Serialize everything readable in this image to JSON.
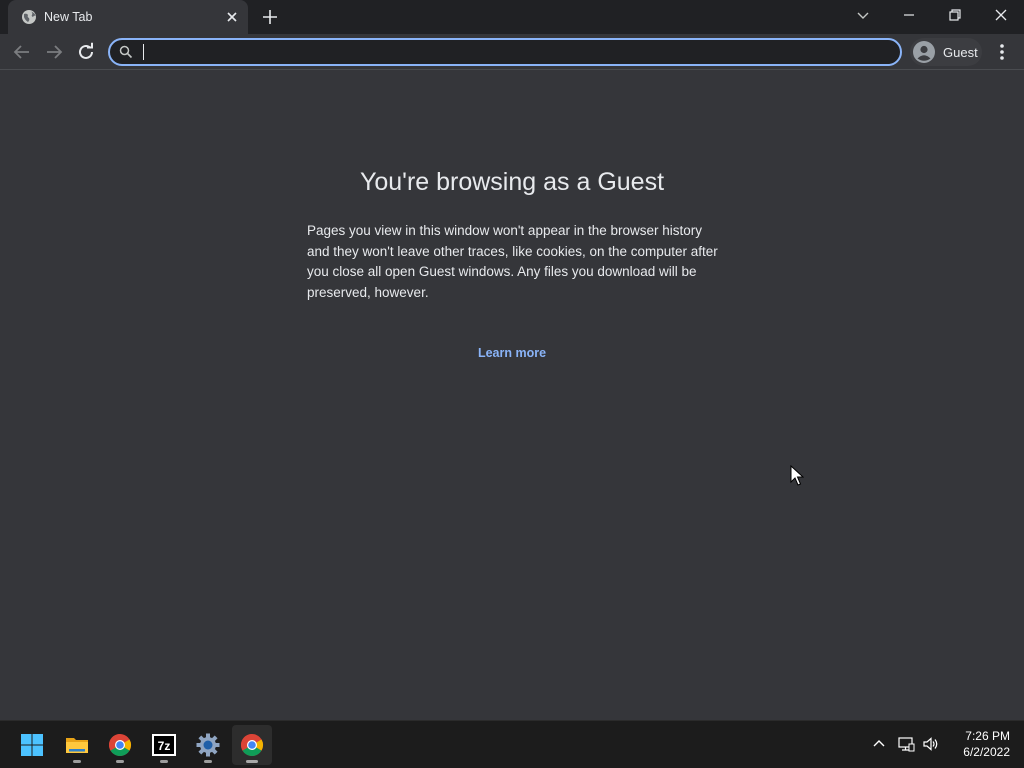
{
  "browser": {
    "tab": {
      "title": "New Tab",
      "favicon": "globe-icon"
    },
    "omnibox": {
      "value": "",
      "placeholder": ""
    },
    "profile": {
      "label": "Guest",
      "icon": "avatar-icon"
    }
  },
  "content": {
    "heading": "You're browsing as a Guest",
    "description": "Pages you view in this window won't appear in the browser history and they won't leave other traces, like cookies, on the computer after you close all open Guest windows. Any files you download will be preserved, however.",
    "learn_more": "Learn more"
  },
  "taskbar": {
    "apps": [
      {
        "name": "start",
        "icon": "windows-logo-icon"
      },
      {
        "name": "file-explorer",
        "icon": "folder-icon"
      },
      {
        "name": "chrome",
        "icon": "chrome-icon"
      },
      {
        "name": "7zip",
        "icon": "7zip-icon",
        "label": "7z"
      },
      {
        "name": "settings",
        "icon": "gear-icon"
      },
      {
        "name": "chrome-active",
        "icon": "chrome-icon"
      }
    ],
    "clock": {
      "time": "7:26 PM",
      "date": "6/2/2022"
    }
  },
  "colors": {
    "page_bg": "#35363a",
    "tabstrip_bg": "#202124",
    "accent": "#8ab4f8",
    "text": "#e8eaed",
    "taskbar_bg": "#1c1c1c"
  }
}
